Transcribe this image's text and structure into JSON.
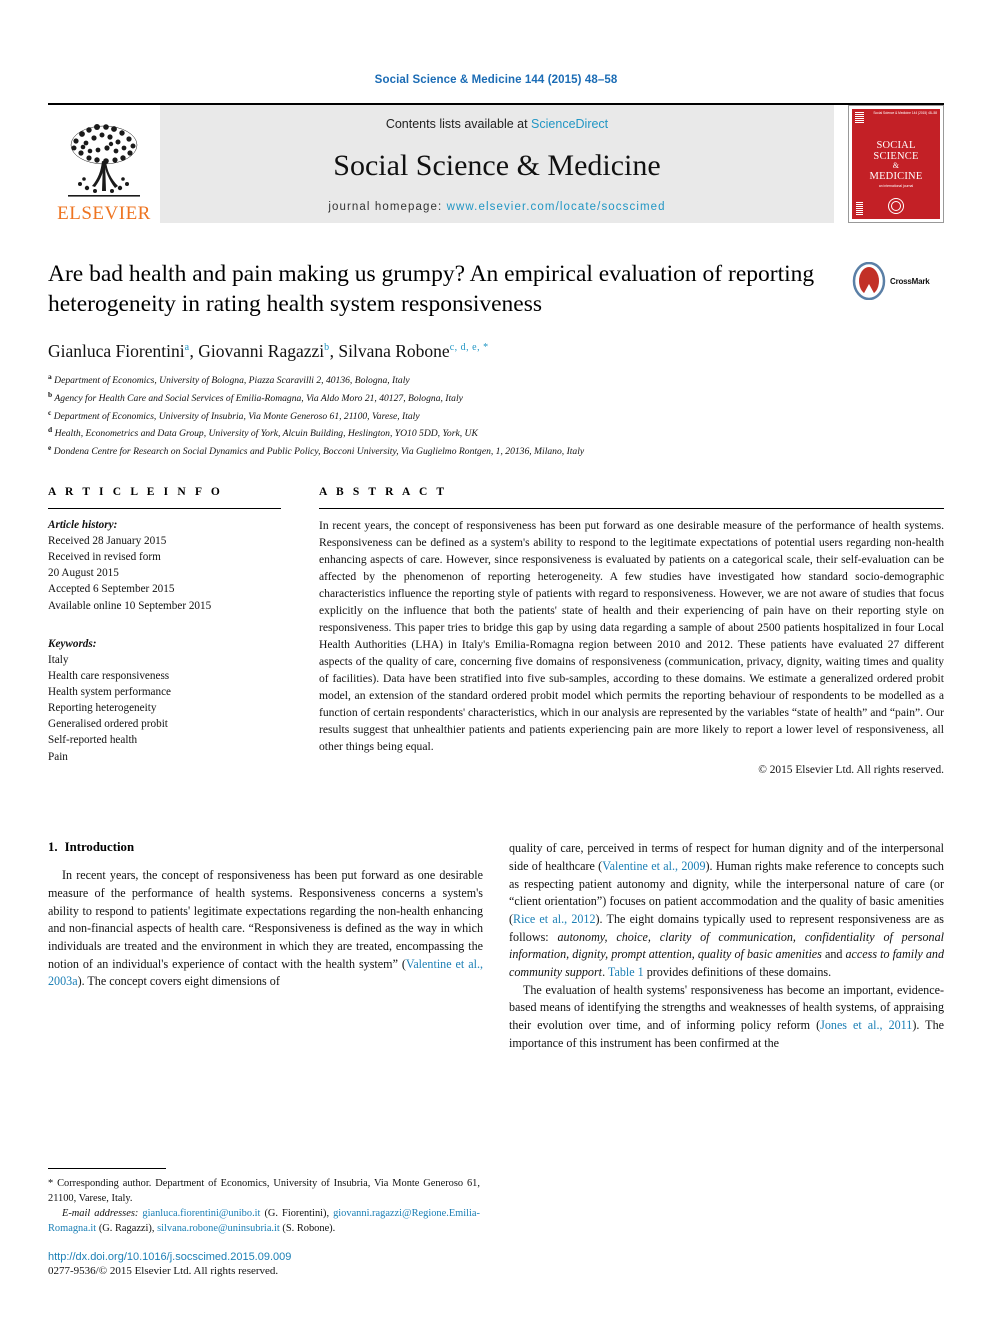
{
  "running_head": "Social Science & Medicine 144 (2015) 48–58",
  "masthead": {
    "publisher_name": "ELSEVIER",
    "contents_prefix": "Contents lists available at ",
    "contents_link": "ScienceDirect",
    "journal_title": "Social Science & Medicine",
    "homepage_prefix": "journal homepage: ",
    "homepage_url": "www.elsevier.com/locate/socscimed",
    "cover": {
      "title_line1": "SOCIAL",
      "title_line2": "SCIENCE",
      "title_line3": "&",
      "title_line4": "MEDICINE",
      "subtitle": "an international journal",
      "color": "#c32026"
    }
  },
  "article": {
    "title": "Are bad health and pain making us grumpy? An empirical evaluation of reporting heterogeneity in rating health system responsiveness",
    "crossmark_label": "CrossMark",
    "authors": [
      {
        "name": "Gianluca Fiorentini",
        "sup": "a",
        "sep": ", "
      },
      {
        "name": "Giovanni Ragazzi",
        "sup": "b",
        "sep": ", "
      },
      {
        "name": "Silvana Robone",
        "sup": "c, d, e, *",
        "sep": ""
      }
    ],
    "affiliations": [
      {
        "mark": "a",
        "text": "Department of Economics, University of Bologna, Piazza Scaravilli 2, 40136, Bologna, Italy"
      },
      {
        "mark": "b",
        "text": "Agency for Health Care and Social Services of Emilia-Romagna, Via Aldo Moro 21, 40127, Bologna, Italy"
      },
      {
        "mark": "c",
        "text": "Department of Economics, University of Insubria, Via Monte Generoso 61, 21100, Varese, Italy"
      },
      {
        "mark": "d",
        "text": "Health, Econometrics and Data Group, University of York, Alcuin Building, Heslington, YO10 5DD, York, UK"
      },
      {
        "mark": "e",
        "text": "Dondena Centre for Research on Social Dynamics and Public Policy, Bocconi University, Via Guglielmo Rontgen, 1, 20136, Milano, Italy"
      }
    ]
  },
  "article_info": {
    "heading": "A R T I C L E  I N F O",
    "history_label": "Article history:",
    "history": [
      "Received 28 January 2015",
      "Received in revised form",
      "20 August 2015",
      "Accepted 6 September 2015",
      "Available online 10 September 2015"
    ],
    "keywords_label": "Keywords:",
    "keywords": [
      "Italy",
      "Health care responsiveness",
      "Health system performance",
      "Reporting heterogeneity",
      "Generalised ordered probit",
      "Self-reported health",
      "Pain"
    ]
  },
  "abstract": {
    "heading": "A B S T R A C T",
    "text": "In recent years, the concept of responsiveness has been put forward as one desirable measure of the performance of health systems. Responsiveness can be defined as a system's ability to respond to the legitimate expectations of potential users regarding non-health enhancing aspects of care. However, since responsiveness is evaluated by patients on a categorical scale, their self-evaluation can be affected by the phenomenon of reporting heterogeneity. A few studies have investigated how standard socio-demographic characteristics influence the reporting style of patients with regard to responsiveness. However, we are not aware of studies that focus explicitly on the influence that both the patients' state of health and their experiencing of pain have on their reporting style on responsiveness. This paper tries to bridge this gap by using data regarding a sample of about 2500 patients hospitalized in four Local Health Authorities (LHA) in Italy's Emilia-Romagna region between 2010 and 2012. These patients have evaluated 27 different aspects of the quality of care, concerning five domains of responsiveness (communication, privacy, dignity, waiting times and quality of facilities). Data have been stratified into five sub-samples, according to these domains. We estimate a generalized ordered probit model, an extension of the standard ordered probit model which permits the reporting behaviour of respondents to be modelled as a function of certain respondents' characteristics, which in our analysis are represented by the variables “state of health” and “pain”. Our results suggest that unhealthier patients and patients experiencing pain are more likely to report a lower level of responsiveness, all other things being equal.",
    "copyright": "© 2015 Elsevier Ltd. All rights reserved."
  },
  "body": {
    "section_number": "1.",
    "section_title": "Introduction",
    "left_para_1_a": "In recent years, the concept of responsiveness has been put forward as one desirable measure of the performance of health systems. Responsiveness concerns a system's ability to respond to patients' legitimate expectations regarding the non-health enhancing and non-financial aspects of health care. “Responsiveness is defined as the way in which individuals are treated and the environment in which they are treated, encompassing the notion of an individual's experience of contact with the health system” (",
    "left_ref_1": "Valentine et al., 2003a",
    "left_para_1_b": "). The concept covers eight dimensions of",
    "right_para_1_a": "quality of care, perceived in terms of respect for human dignity and of the interpersonal side of healthcare (",
    "right_ref_1": "Valentine et al., 2009",
    "right_para_1_b": "). Human rights make reference to concepts such as respecting patient autonomy and dignity, while the interpersonal nature of care (or “client orientation”) focuses on patient accommodation and the quality of basic amenities (",
    "right_ref_2": "Rice et al., 2012",
    "right_para_1_c": "). The eight domains typically used to represent responsiveness are as follows: ",
    "right_italic_1": "autonomy, choice, clarity of communication, confidentiality of personal information, dignity, prompt attention, quality of basic amenities",
    "right_para_1_d": " and ",
    "right_italic_2": "access to family and community support",
    "right_para_1_e": ". ",
    "right_ref_3": "Table 1",
    "right_para_1_f": " provides definitions of these domains.",
    "right_para_2_a": "The evaluation of health systems' responsiveness has become an important, evidence-based means of identifying the strengths and weaknesses of health systems, of appraising their evolution over time, and of informing policy reform (",
    "right_ref_4": "Jones et al., 2011",
    "right_para_2_b": "). The importance of this instrument has been confirmed at the"
  },
  "footnote": {
    "corresponding_mark": "*",
    "corresponding_text": "Corresponding author. Department of Economics, University of Insubria, Via Monte Generoso 61, 21100, Varese, Italy.",
    "email_label": "E-mail addresses:",
    "emails": [
      {
        "address": "gianluca.fiorentini@unibo.it",
        "who": "(G. Fiorentini)"
      },
      {
        "address": "giovanni.ragazzi@Regione.Emilia-Romagna.it",
        "who": "(G. Ragazzi)"
      },
      {
        "address": "silvana.robone@uninsubria.it",
        "who": "(S. Robone)"
      }
    ],
    "doi": "http://dx.doi.org/10.1016/j.socscimed.2015.09.009",
    "issn": "0277-9536/© 2015 Elsevier Ltd. All rights reserved."
  },
  "colors": {
    "link": "#1b7fb5",
    "sciencedirect": "#2196c4",
    "elsevier_orange": "#ee7421",
    "cover_red": "#c32026"
  }
}
